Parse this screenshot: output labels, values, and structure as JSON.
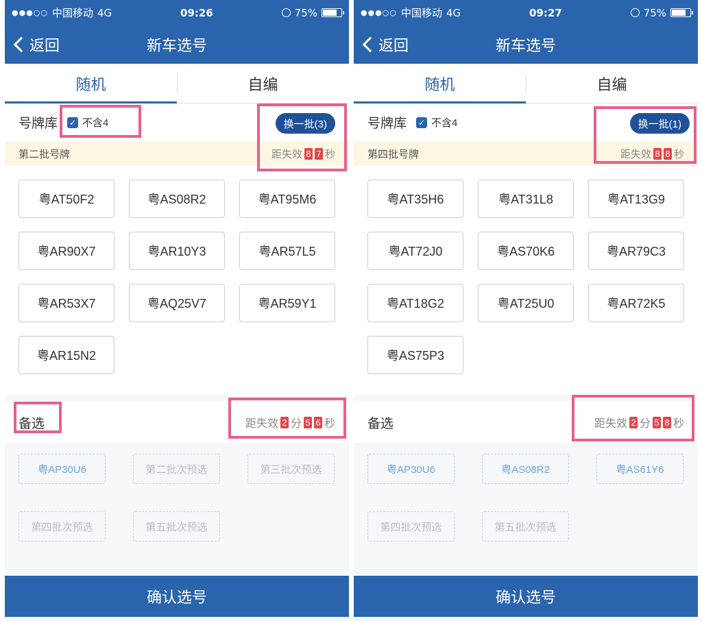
{
  "screens": [
    {
      "status": {
        "carrier": "中国移动",
        "network": "4G",
        "time": "09:26",
        "battery": "75%",
        "battery_level": 0.75
      },
      "nav": {
        "back_label": "返回",
        "title": "新车选号"
      },
      "tabs": [
        {
          "label": "随机",
          "active": true
        },
        {
          "label": "自编",
          "active": false
        }
      ],
      "library": {
        "title": "号牌库",
        "checkbox_label": "不含4",
        "checked": true,
        "swap_label": "换一批(3)"
      },
      "batch": {
        "label": "第二批号牌",
        "countdown_prefix": "距失效",
        "seconds_digits": [
          "8",
          "7"
        ],
        "seconds_unit": "秒"
      },
      "plates": [
        "粤AT50F2",
        "粤AS08R2",
        "粤AT95M6",
        "粤AR90X7",
        "粤AR10Y3",
        "粤AR57L5",
        "粤AR53X7",
        "粤AQ25V7",
        "粤AR59Y1",
        "粤AR15N2"
      ],
      "alternate": {
        "title": "备选",
        "countdown_prefix": "距失效",
        "minutes_digits": [
          "2"
        ],
        "minutes_unit": "分",
        "seconds_digits": [
          "5",
          "6"
        ],
        "seconds_unit": "秒",
        "slots": [
          {
            "label": "粤AP30U6",
            "filled": true
          },
          {
            "label": "第二批次预选",
            "filled": false
          },
          {
            "label": "第三批次预选",
            "filled": false
          },
          {
            "label": "第四批次预选",
            "filled": false
          },
          {
            "label": "第五批次预选",
            "filled": false
          }
        ]
      },
      "confirm_label": "确认选号"
    },
    {
      "status": {
        "carrier": "中国移动",
        "network": "4G",
        "time": "09:27",
        "battery": "75%",
        "battery_level": 0.75
      },
      "nav": {
        "back_label": "返回",
        "title": "新车选号"
      },
      "tabs": [
        {
          "label": "随机",
          "active": true
        },
        {
          "label": "自编",
          "active": false
        }
      ],
      "library": {
        "title": "号牌库",
        "checkbox_label": "不含4",
        "checked": true,
        "swap_label": "换一批(1)"
      },
      "batch": {
        "label": "第四批号牌",
        "countdown_prefix": "距失效",
        "seconds_digits": [
          "8",
          "8"
        ],
        "seconds_unit": "秒"
      },
      "plates": [
        "粤AT35H6",
        "粤AT31L8",
        "粤AT13G9",
        "粤AT72J0",
        "粤AS70K6",
        "粤AR79C3",
        "粤AT18G2",
        "粤AT25U0",
        "粤AR72K5",
        "粤AS75P3"
      ],
      "alternate": {
        "title": "备选",
        "countdown_prefix": "距失效",
        "minutes_digits": [
          "2"
        ],
        "minutes_unit": "分",
        "seconds_digits": [
          "5",
          "8"
        ],
        "seconds_unit": "秒",
        "slots": [
          {
            "label": "粤AP30U6",
            "filled": true
          },
          {
            "label": "粤AS08R2",
            "filled": true
          },
          {
            "label": "粤AS61Y6",
            "filled": true
          },
          {
            "label": "第四批次预选",
            "filled": false
          },
          {
            "label": "第五批次预选",
            "filled": false
          }
        ]
      },
      "confirm_label": "确认选号"
    }
  ],
  "colors": {
    "primary": "#2a64ad",
    "button_dark": "#1f5199",
    "highlight": "#e8608c",
    "digit_red": "#e6444a",
    "batch_bg": "#fdf6e3"
  }
}
